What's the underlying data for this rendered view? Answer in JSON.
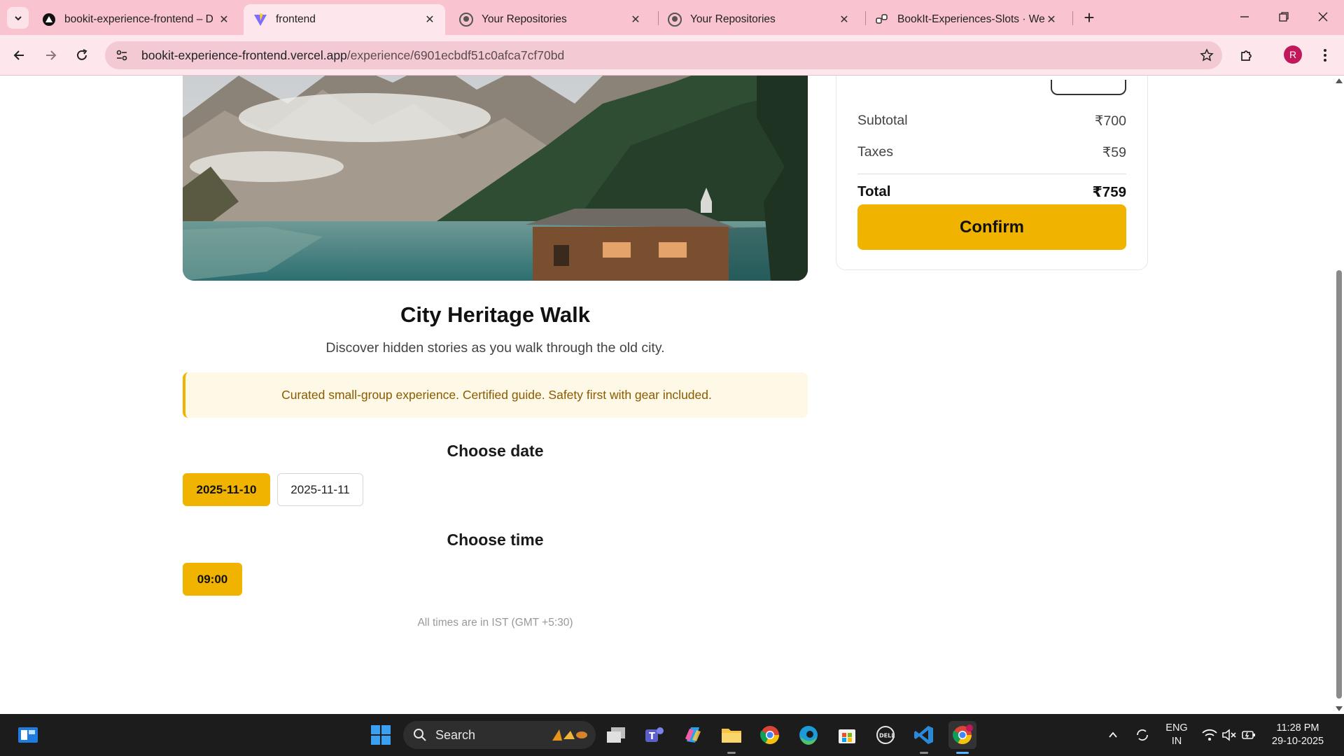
{
  "browser": {
    "tabs": [
      {
        "title": "bookit-experience-frontend – D",
        "icon": "vercel-icon",
        "active": false
      },
      {
        "title": "frontend",
        "icon": "vite-icon",
        "active": true
      },
      {
        "title": "Your Repositories",
        "icon": "github-icon",
        "active": false
      },
      {
        "title": "Your Repositories",
        "icon": "github-icon",
        "active": false
      },
      {
        "title": "BookIt-Experiences-Slots · Web",
        "icon": "render-icon",
        "active": false
      }
    ],
    "url_host": "bookit-experience-frontend.vercel.app",
    "url_path": "/experience/6901ecbdf51c0afca7cf70bd",
    "profile_initial": "R"
  },
  "experience": {
    "title": "City Heritage Walk",
    "description": "Discover hidden stories as you walk through the old city.",
    "notice": "Curated small-group experience. Certified guide. Safety first with gear included.",
    "date_heading": "Choose date",
    "dates": [
      {
        "label": "2025-11-10",
        "selected": true
      },
      {
        "label": "2025-11-11",
        "selected": false
      }
    ],
    "time_heading": "Choose time",
    "times": [
      {
        "label": "09:00",
        "selected": true
      }
    ],
    "timezone_note": "All times are in IST (GMT +5:30)"
  },
  "summary": {
    "subtotal_label": "Subtotal",
    "subtotal_value": "₹700",
    "taxes_label": "Taxes",
    "taxes_value": "₹59",
    "total_label": "Total",
    "total_value": "₹759",
    "confirm_label": "Confirm"
  },
  "taskbar": {
    "search_label": "Search",
    "language_line1": "ENG",
    "language_line2": "IN",
    "time": "11:28 PM",
    "date": "29-10-2025"
  },
  "colors": {
    "accent": "#f0b400",
    "tabstrip": "#f9c3cf",
    "notice_bg": "#fef9e6",
    "notice_text": "#8a5a00"
  }
}
